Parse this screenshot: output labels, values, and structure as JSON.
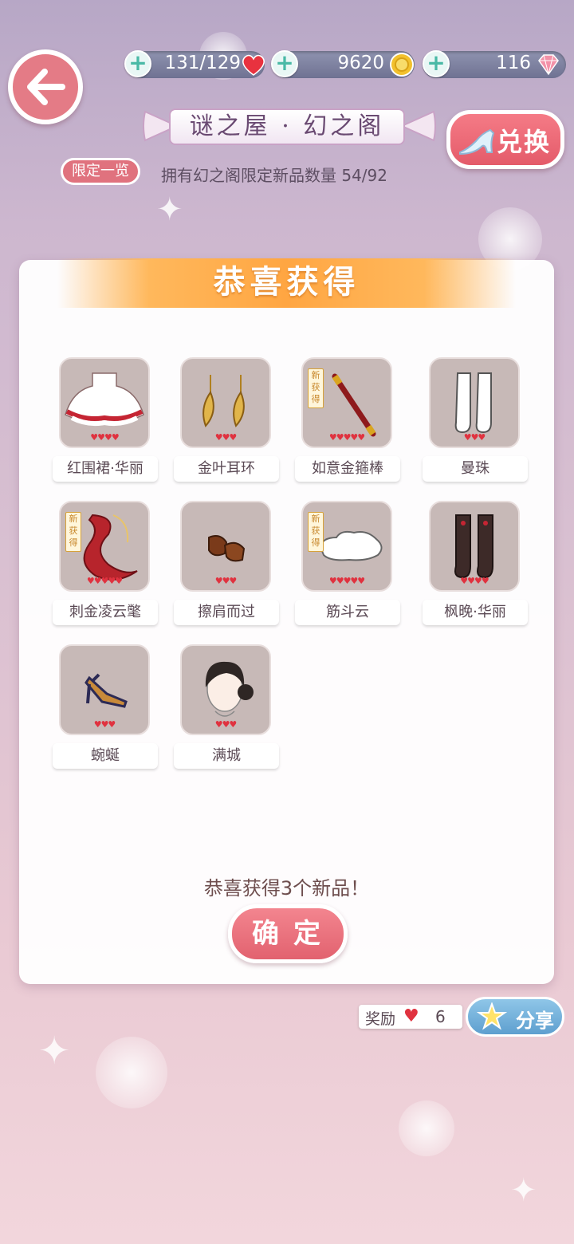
{
  "header": {
    "back_label": "",
    "hearts_value": "131/129",
    "coins_value": "9620",
    "diamonds_value": "116",
    "title": "谜之屋 · 幻之阁",
    "exchange_label": "兑换",
    "limited_label": "限定一览",
    "owned_text": "拥有幻之阁限定新品数量 54/92"
  },
  "panel": {
    "banner": "恭喜获得",
    "new_tag": "新获得",
    "items": [
      {
        "name": "红围裙·华丽",
        "hearts": "♥♥♥♥",
        "icon": "apron-icon",
        "new": false
      },
      {
        "name": "金叶耳环",
        "hearts": "♥♥♥",
        "icon": "leaf-earrings-icon",
        "new": false
      },
      {
        "name": "如意金箍棒",
        "hearts": "♥♥♥♥♥",
        "icon": "golden-staff-icon",
        "new": true
      },
      {
        "name": "曼珠",
        "hearts": "♥♥♥",
        "icon": "white-stockings-icon",
        "new": false
      },
      {
        "name": "刺金凌云氅",
        "hearts": "♥♥♥♥♥",
        "icon": "red-cloak-icon",
        "new": true
      },
      {
        "name": "擦肩而过",
        "hearts": "♥♥♥",
        "icon": "brown-shoes-icon",
        "new": false
      },
      {
        "name": "筋斗云",
        "hearts": "♥♥♥♥♥",
        "icon": "cloud-icon",
        "new": true
      },
      {
        "name": "枫晚·华丽",
        "hearts": "♥♥♥♥",
        "icon": "dark-stockings-icon",
        "new": false
      },
      {
        "name": "蜿蜒",
        "hearts": "♥♥♥",
        "icon": "sandals-icon",
        "new": false
      },
      {
        "name": "满城",
        "hearts": "♥♥♥",
        "icon": "hairstyle-icon",
        "new": false
      }
    ],
    "congrats_text": "恭喜获得3个新品！",
    "confirm_label": "确定"
  },
  "footer": {
    "reward_label": "奖励",
    "reward_count": "6",
    "share_label": "分享"
  },
  "colors": {
    "accent_pink": "#e47b86",
    "banner_orange": "#ffa642",
    "heart_red": "#e0323f",
    "plus_teal": "#49b9a6"
  }
}
